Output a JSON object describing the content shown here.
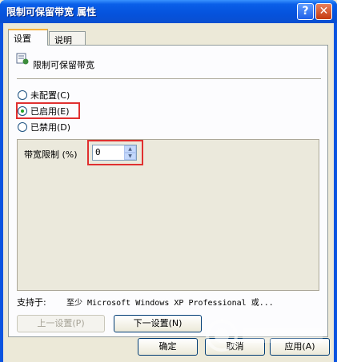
{
  "window": {
    "title": "限制可保留带宽 属性",
    "help_glyph": "?",
    "close_glyph": "✕"
  },
  "tabs": [
    {
      "label": "设置",
      "active": true
    },
    {
      "label": "说明",
      "active": false
    }
  ],
  "policy": {
    "name": "限制可保留带宽",
    "icon": "policy-setting-icon"
  },
  "radios": [
    {
      "label": "未配置(C)",
      "checked": false
    },
    {
      "label": "已启用(E)",
      "checked": true
    },
    {
      "label": "已禁用(D)",
      "checked": false
    }
  ],
  "options": {
    "bandwidth_label": "带宽限制 (%)",
    "bandwidth_value": "0"
  },
  "supported": {
    "label": "支持于:",
    "value": "至少 Microsoft Windows XP Professional 或..."
  },
  "nav": {
    "prev_label": "上一设置(P)",
    "next_label": "下一设置(N)"
  },
  "footer": {
    "ok_label": "确定",
    "cancel_label": "取消",
    "apply_label": "应用(A)"
  },
  "colors": {
    "highlight": "#e03030",
    "title_bar": "#0552dc"
  }
}
